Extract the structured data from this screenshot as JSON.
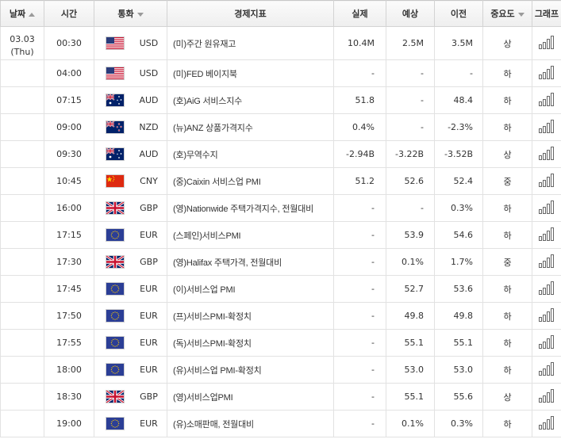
{
  "headers": {
    "date": "날짜",
    "time": "시간",
    "currency": "통화",
    "event": "경제지표",
    "actual": "실제",
    "forecast": "예상",
    "previous": "이전",
    "importance": "중요도",
    "graph": "그래프"
  },
  "date": {
    "day": "03.03",
    "weekday": "(Thu)"
  },
  "icons": {
    "graph": "bar-chart-icon",
    "sort_asc": "sort-up-arrow-icon",
    "dropdown": "dropdown-arrow-icon"
  },
  "rows": [
    {
      "time": "00:30",
      "flag": "us",
      "currency": "USD",
      "event": "(미)주간 원유재고",
      "actual": "10.4M",
      "forecast": "2.5M",
      "previous": "3.5M",
      "importance": "상"
    },
    {
      "time": "04:00",
      "flag": "us",
      "currency": "USD",
      "event": "(미)FED 베이지북",
      "actual": "-",
      "forecast": "-",
      "previous": "-",
      "importance": "하"
    },
    {
      "time": "07:15",
      "flag": "au",
      "currency": "AUD",
      "event": "(호)AiG 서비스지수",
      "actual": "51.8",
      "forecast": "-",
      "previous": "48.4",
      "importance": "하"
    },
    {
      "time": "09:00",
      "flag": "nz",
      "currency": "NZD",
      "event": "(뉴)ANZ 상품가격지수",
      "actual": "0.4%",
      "forecast": "-",
      "previous": "-2.3%",
      "importance": "하"
    },
    {
      "time": "09:30",
      "flag": "au",
      "currency": "AUD",
      "event": "(호)무역수지",
      "actual": "-2.94B",
      "forecast": "-3.22B",
      "previous": "-3.52B",
      "importance": "상"
    },
    {
      "time": "10:45",
      "flag": "cn",
      "currency": "CNY",
      "event": "(중)Caixin 서비스업 PMI",
      "actual": "51.2",
      "forecast": "52.6",
      "previous": "52.4",
      "importance": "중"
    },
    {
      "time": "16:00",
      "flag": "gb",
      "currency": "GBP",
      "event": "(영)Nationwide 주택가격지수, 전월대비",
      "actual": "-",
      "forecast": "-",
      "previous": "0.3%",
      "importance": "하"
    },
    {
      "time": "17:15",
      "flag": "eu",
      "currency": "EUR",
      "event": "(스페인)서비스PMI",
      "actual": "-",
      "forecast": "53.9",
      "previous": "54.6",
      "importance": "하"
    },
    {
      "time": "17:30",
      "flag": "gb",
      "currency": "GBP",
      "event": "(영)Halifax 주택가격, 전월대비",
      "actual": "-",
      "forecast": "0.1%",
      "previous": "1.7%",
      "importance": "중"
    },
    {
      "time": "17:45",
      "flag": "eu",
      "currency": "EUR",
      "event": "(이)서비스업 PMI",
      "actual": "-",
      "forecast": "52.7",
      "previous": "53.6",
      "importance": "하"
    },
    {
      "time": "17:50",
      "flag": "eu",
      "currency": "EUR",
      "event": "(프)서비스PMI-확정치",
      "actual": "-",
      "forecast": "49.8",
      "previous": "49.8",
      "importance": "하"
    },
    {
      "time": "17:55",
      "flag": "eu",
      "currency": "EUR",
      "event": "(독)서비스PMI-확정치",
      "actual": "-",
      "forecast": "55.1",
      "previous": "55.1",
      "importance": "하"
    },
    {
      "time": "18:00",
      "flag": "eu",
      "currency": "EUR",
      "event": "(유)서비스업 PMI-확정치",
      "actual": "-",
      "forecast": "53.0",
      "previous": "53.0",
      "importance": "하"
    },
    {
      "time": "18:30",
      "flag": "gb",
      "currency": "GBP",
      "event": "(영)서비스업PMI",
      "actual": "-",
      "forecast": "55.1",
      "previous": "55.6",
      "importance": "상"
    },
    {
      "time": "19:00",
      "flag": "eu",
      "currency": "EUR",
      "event": "(유)소매판매, 전월대비",
      "actual": "-",
      "forecast": "0.1%",
      "previous": "0.3%",
      "importance": "하"
    }
  ]
}
